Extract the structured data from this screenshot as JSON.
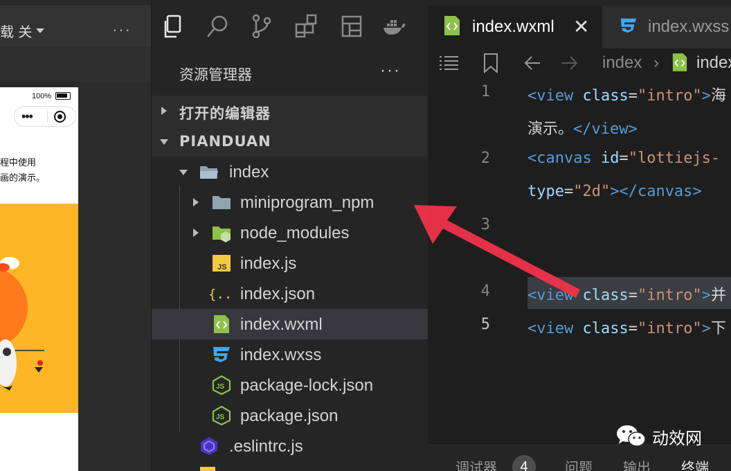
{
  "simulator": {
    "toolbar_label": "载 关",
    "more": "···",
    "phone": {
      "battery": "100%",
      "capsule_more": "•••",
      "text_line_1": "程中使用",
      "text_line_2": "画的演示。"
    }
  },
  "activity_bar": {
    "icons": [
      "explorer-icon",
      "search-icon",
      "source-control-icon",
      "extensions-icon",
      "layout-icon",
      "docker-icon"
    ]
  },
  "explorer": {
    "title": "资源管理器",
    "more": "···",
    "open_editors": "打开的编辑器",
    "project": "PIANDUAN",
    "tree": [
      {
        "label": "index",
        "type": "folder-open",
        "icon": "folder-open-icon"
      },
      {
        "label": "miniprogram_npm",
        "type": "folder",
        "icon": "folder-icon"
      },
      {
        "label": "node_modules",
        "type": "folder",
        "icon": "node-folder-icon"
      },
      {
        "label": "index.js",
        "type": "file",
        "icon": "js-file-icon",
        "badge": "JS"
      },
      {
        "label": "index.json",
        "type": "file",
        "icon": "json-file-icon",
        "badge": "{...}"
      },
      {
        "label": "index.wxml",
        "type": "file",
        "icon": "wxml-file-icon",
        "selected": true
      },
      {
        "label": "index.wxss",
        "type": "file",
        "icon": "css-file-icon"
      },
      {
        "label": "package-lock.json",
        "type": "file",
        "icon": "nodejs-file-icon"
      },
      {
        "label": "package.json",
        "type": "file",
        "icon": "nodejs-file-icon"
      },
      {
        "label": ".eslintrc.js",
        "type": "file",
        "icon": "eslint-file-icon"
      }
    ]
  },
  "editor": {
    "tabs": [
      {
        "label": "index.wxml",
        "active": true,
        "close": "✕"
      },
      {
        "label": "index.wxss",
        "active": false
      }
    ],
    "breadcrumb": [
      "index",
      "index"
    ],
    "lines": [
      {
        "num": "1",
        "tokens": [
          [
            "tag",
            "<view "
          ],
          [
            "attr",
            "class"
          ],
          [
            "txt",
            "="
          ],
          [
            "str",
            "\"intro\""
          ],
          [
            "tag",
            ">"
          ],
          [
            "txt",
            "海"
          ]
        ]
      },
      {
        "num": "",
        "tokens": [
          [
            "txt",
            "演示。"
          ],
          [
            "tag",
            "</view>"
          ]
        ]
      },
      {
        "num": "2",
        "tokens": [
          [
            "tag",
            "<canvas "
          ],
          [
            "attr",
            "id"
          ],
          [
            "txt",
            "="
          ],
          [
            "str",
            "\"lottiejs-"
          ]
        ]
      },
      {
        "num": "",
        "tokens": [
          [
            "attr",
            "type"
          ],
          [
            "txt",
            "="
          ],
          [
            "str",
            "\"2d\""
          ],
          [
            "tag",
            "></canvas>"
          ]
        ]
      },
      {
        "num": "3",
        "tokens": []
      },
      {
        "num": "",
        "tokens": []
      },
      {
        "num": "4",
        "tokens": [
          [
            "tag",
            "<view "
          ],
          [
            "attr",
            "class"
          ],
          [
            "txt",
            "="
          ],
          [
            "str",
            "\"intro\""
          ],
          [
            "tag",
            ">"
          ],
          [
            "txt",
            "并"
          ]
        ]
      },
      {
        "num": "5",
        "tokens": [
          [
            "tag",
            "<view "
          ],
          [
            "attr",
            "class"
          ],
          [
            "txt",
            "="
          ],
          [
            "str",
            "\"intro\""
          ],
          [
            "tag",
            ">"
          ],
          [
            "txt",
            "下"
          ]
        ],
        "active": true
      }
    ]
  },
  "panel": {
    "tabs": [
      "调试器",
      "问题",
      "输出",
      "终端"
    ],
    "badge": "4"
  },
  "watermark": "动效网",
  "colors": {
    "accent_arrow": "#f0334a",
    "wxml_green": "#8dc149",
    "css_blue": "#42a5f5",
    "js_yellow": "#f5c842"
  }
}
